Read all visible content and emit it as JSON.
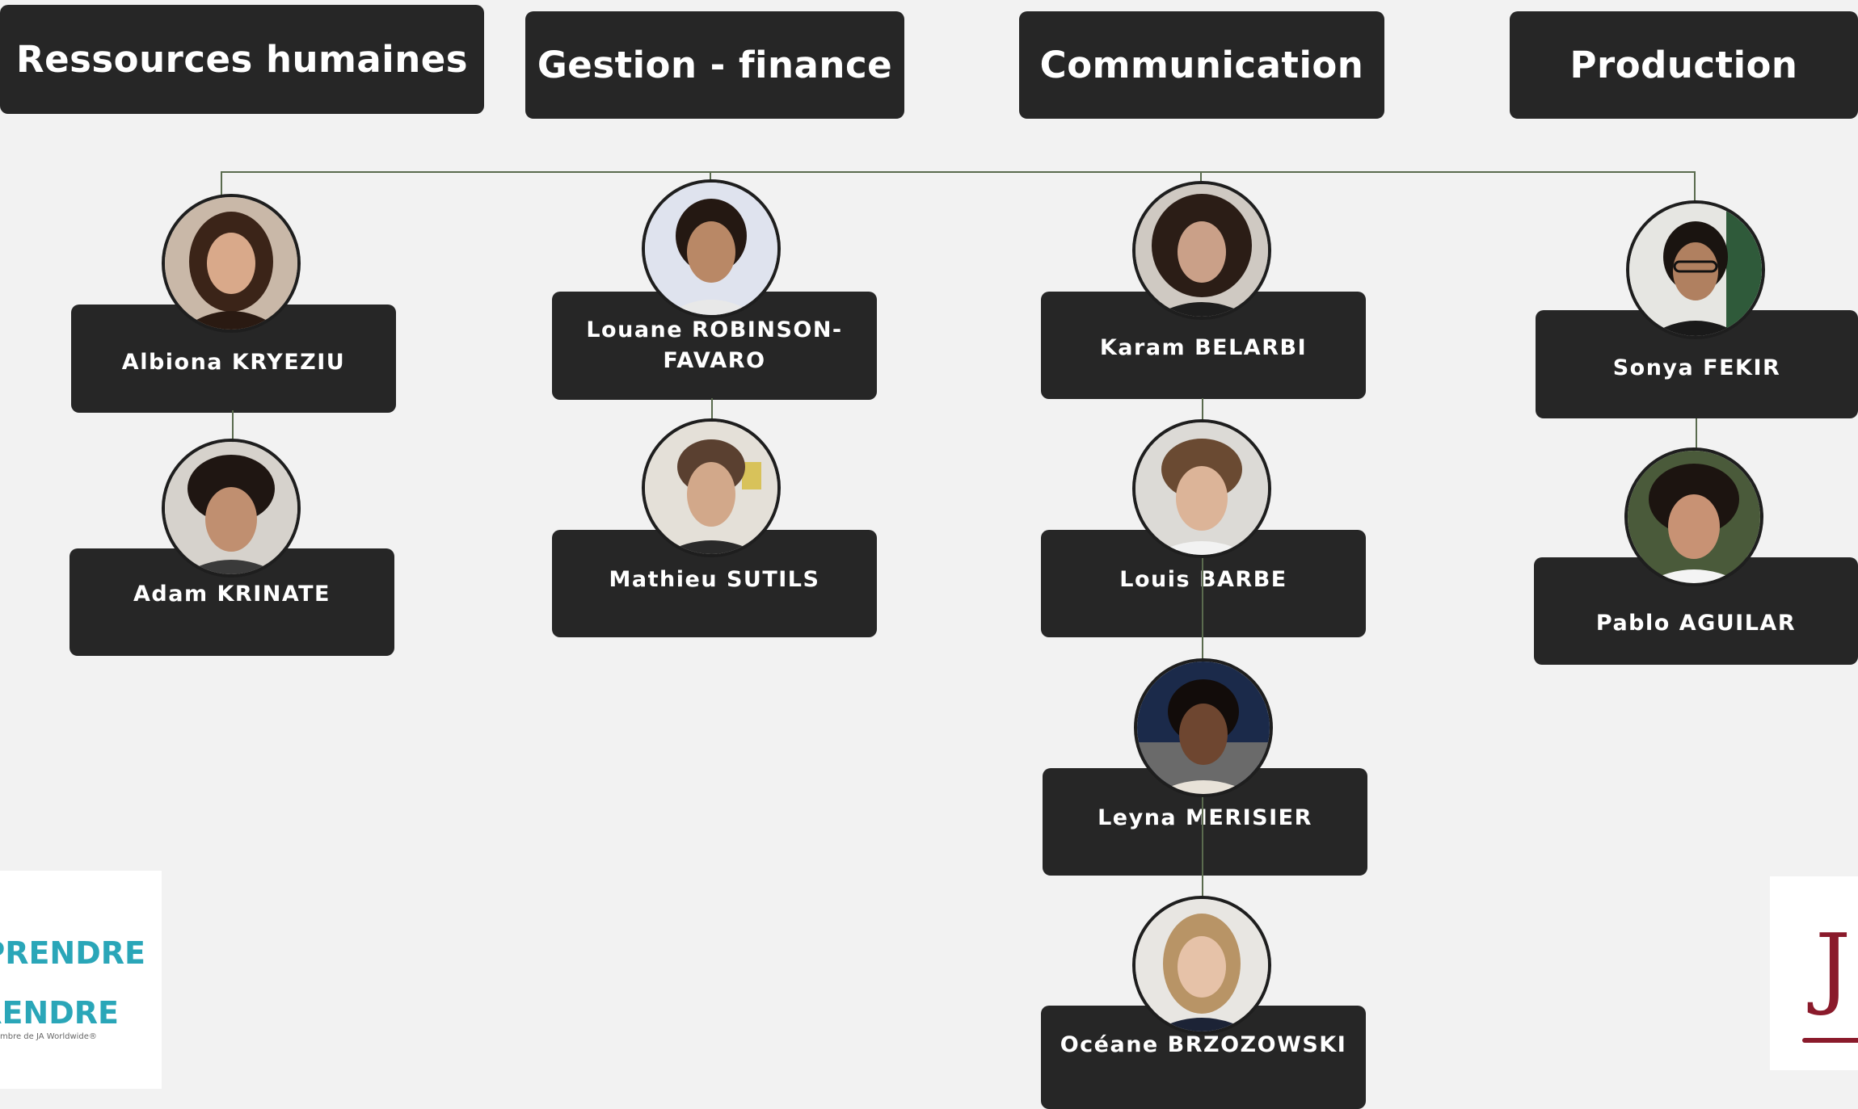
{
  "departments": [
    {
      "label": "Ressources humaines"
    },
    {
      "label": "Gestion - finance"
    },
    {
      "label": "Communication"
    },
    {
      "label": "Production"
    }
  ],
  "members": [
    {
      "name": "Albiona KRYEZIU",
      "department": "Ressources humaines"
    },
    {
      "name": "Adam KRINATE",
      "department": "Ressources humaines"
    },
    {
      "name": "Louane ROBINSON-\nFAVARO",
      "department": "Gestion - finance"
    },
    {
      "name": "Mathieu SUTILS",
      "department": "Gestion - finance"
    },
    {
      "name": "Karam BELARBI",
      "department": "Communication"
    },
    {
      "name": "Louis BARBE",
      "department": "Communication"
    },
    {
      "name": "Leyna MERISIER",
      "department": "Communication"
    },
    {
      "name": "Océane BRZOZOWSKI",
      "department": "Communication"
    },
    {
      "name": "Sonya FEKIR",
      "department": "Production"
    },
    {
      "name": "Pablo AGUILAR",
      "department": "Production"
    }
  ],
  "logo_left": {
    "line1": "PRENDRE",
    "line2": "RENDRE",
    "line3": "mbre de JA Worldwide®",
    "accent_color": "#2aa6b8"
  },
  "logo_right": {
    "text": "J",
    "accent_color": "#8a1a2b"
  },
  "colors": {
    "background": "#f2f2f2",
    "box": "#262626",
    "connector": "#5a6b4e",
    "text": "#ffffff"
  }
}
